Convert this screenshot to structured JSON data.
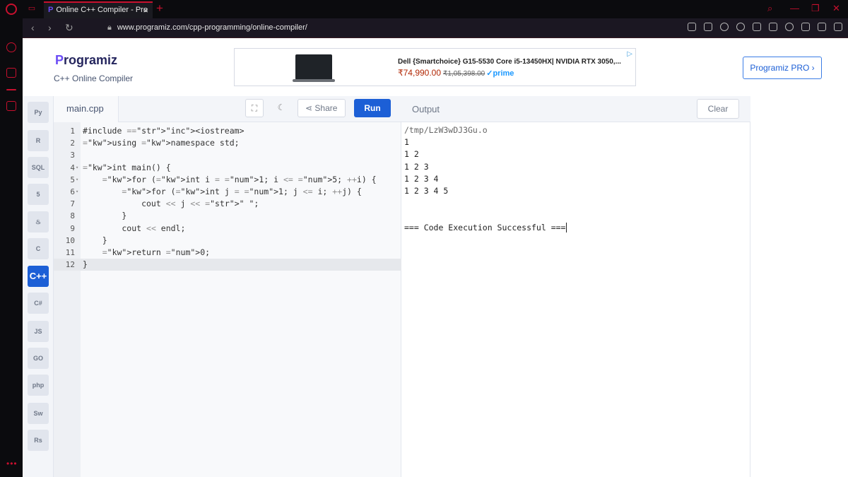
{
  "browser": {
    "tab_title": "Online C++ Compiler - Pro",
    "url": "www.programiz.com/cpp-programming/online-compiler/"
  },
  "header": {
    "logo_p": "P",
    "logo_rest": "rogramiz",
    "subtitle": "C++ Online Compiler",
    "pro_button": "Programiz PRO ›"
  },
  "ad": {
    "title": "Dell {Smartchoice} G15-5530 Core i5-13450HX| NVIDIA RTX 3050,...",
    "price": "₹74,990.00",
    "mrp": "₹1,05,398.00",
    "prime": "✓prime"
  },
  "languages": [
    "Py",
    "R",
    "SQL",
    "5",
    "♨",
    "C",
    "C++",
    "C#",
    "JS",
    "GO",
    "php",
    "Sw",
    "Rs"
  ],
  "editor": {
    "file_name": "main.cpp",
    "share_label": "Share",
    "run_label": "Run",
    "lines": [
      {
        "num": "1",
        "fold": "",
        "text": "#include <iostream>"
      },
      {
        "num": "2",
        "fold": "",
        "text": "using namespace std;"
      },
      {
        "num": "3",
        "fold": "",
        "text": ""
      },
      {
        "num": "4",
        "fold": "▾",
        "text": "int main() {"
      },
      {
        "num": "5",
        "fold": "▾",
        "text": "    for (int i = 1; i <= 5; ++i) {"
      },
      {
        "num": "6",
        "fold": "▾",
        "text": "        for (int j = 1; j <= i; ++j) {"
      },
      {
        "num": "7",
        "fold": "",
        "text": "            cout << j << \" \";"
      },
      {
        "num": "8",
        "fold": "",
        "text": "        }"
      },
      {
        "num": "9",
        "fold": "",
        "text": "        cout << endl;"
      },
      {
        "num": "10",
        "fold": "",
        "text": "    }"
      },
      {
        "num": "11",
        "fold": "",
        "text": "    return 0;"
      },
      {
        "num": "12",
        "fold": "",
        "text": "}"
      }
    ]
  },
  "output": {
    "title": "Output",
    "clear_label": "Clear",
    "path": "/tmp/LzW3wDJ3Gu.o",
    "lines": [
      "1",
      "1 2",
      "1 2 3",
      "1 2 3 4",
      "1 2 3 4 5",
      "",
      "",
      "=== Code Execution Successful ==="
    ]
  }
}
